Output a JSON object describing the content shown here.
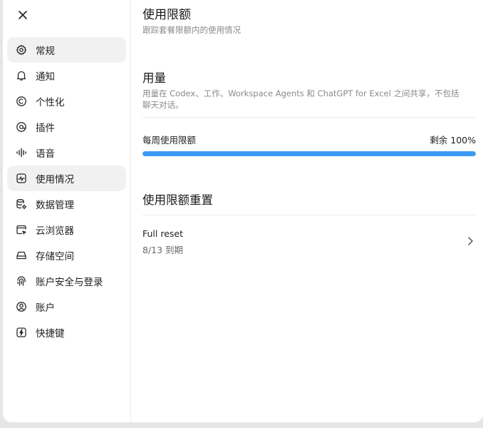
{
  "sidebar": {
    "close_icon": "close-icon",
    "items": [
      {
        "label": "常规",
        "icon": "gear-icon",
        "active": true
      },
      {
        "label": "通知",
        "icon": "bell-icon",
        "active": false
      },
      {
        "label": "个性化",
        "icon": "palette-icon",
        "active": false
      },
      {
        "label": "插件",
        "icon": "plugin-icon",
        "active": false
      },
      {
        "label": "语音",
        "icon": "waveform-icon",
        "active": false
      },
      {
        "label": "使用情况",
        "icon": "usage-chart-icon",
        "active": true
      },
      {
        "label": "数据管理",
        "icon": "database-gear-icon",
        "active": false
      },
      {
        "label": "云浏览器",
        "icon": "cloud-browser-icon",
        "active": false
      },
      {
        "label": "存储空间",
        "icon": "storage-icon",
        "active": false
      },
      {
        "label": "账户安全与登录",
        "icon": "fingerprint-icon",
        "active": false
      },
      {
        "label": "账户",
        "icon": "user-circle-icon",
        "active": false
      },
      {
        "label": "快捷键",
        "icon": "lightning-icon",
        "active": false
      }
    ]
  },
  "main": {
    "title": "使用限额",
    "subtitle": "跟踪套餐限额内的使用情况",
    "usage": {
      "title": "用量",
      "description": "用量在 Codex、工作、Workspace Agents 和 ChatGPT for Excel 之间共享，不包括聊天对话。",
      "weekly_label": "每周使用限额",
      "remaining_label": "剩余 100%",
      "remaining_percent": 100,
      "bar_color": "#3b9bf4"
    },
    "reset": {
      "title": "使用限额重置",
      "item_title": "Full reset",
      "item_date": "8/13 到期",
      "chevron_icon": "chevron-right-icon"
    }
  }
}
